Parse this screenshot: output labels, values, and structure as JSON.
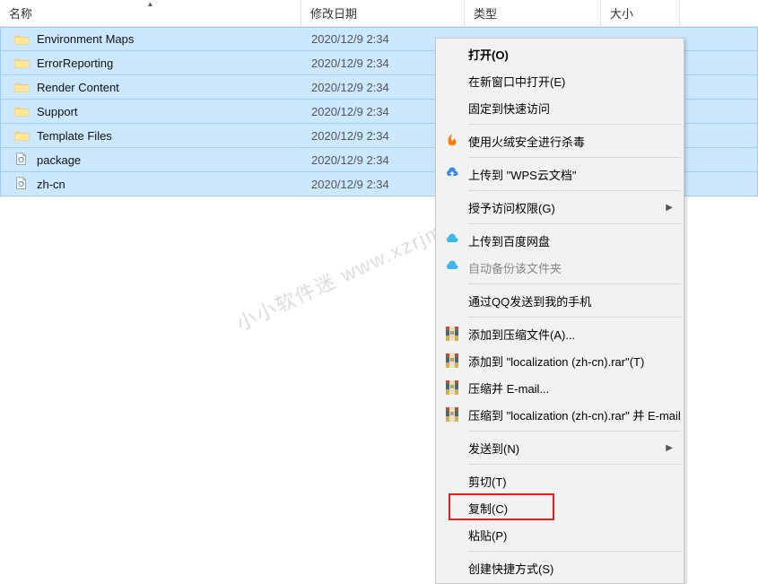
{
  "headers": {
    "name": "名称",
    "date": "修改日期",
    "type": "类型",
    "size": "大小"
  },
  "files": [
    {
      "icon": "folder",
      "name": "Environment Maps",
      "date": "2020/12/9 2:34"
    },
    {
      "icon": "folder",
      "name": "ErrorReporting",
      "date": "2020/12/9 2:34"
    },
    {
      "icon": "folder",
      "name": "Render Content",
      "date": "2020/12/9 2:34"
    },
    {
      "icon": "folder",
      "name": "Support",
      "date": "2020/12/9 2:34"
    },
    {
      "icon": "folder",
      "name": "Template Files",
      "date": "2020/12/9 2:34"
    },
    {
      "icon": "file",
      "name": "package",
      "date": "2020/12/9 2:34"
    },
    {
      "icon": "file",
      "name": "zh-cn",
      "date": "2020/12/9 2:34"
    }
  ],
  "watermark": "小小软件迷 www.xzrjm.com",
  "context_menu": {
    "open": "打开(O)",
    "open_new_window": "在新窗口中打开(E)",
    "pin_quick_access": "固定到快速访问",
    "huorong_scan": "使用火绒安全进行杀毒",
    "upload_wps": "上传到 \"WPS云文档\"",
    "grant_access": "授予访问权限(G)",
    "upload_baidu": "上传到百度网盘",
    "auto_backup": "自动备份该文件夹",
    "send_qq": "通过QQ发送到我的手机",
    "add_archive": "添加到压缩文件(A)...",
    "add_archive_local": "添加到 \"localization (zh-cn).rar\"(T)",
    "compress_email": "压缩并 E-mail...",
    "compress_email_local": "压缩到 \"localization (zh-cn).rar\" 并 E-mail",
    "send_to": "发送到(N)",
    "cut": "剪切(T)",
    "copy": "复制(C)",
    "paste": "粘贴(P)",
    "create_shortcut": "创建快捷方式(S)"
  }
}
